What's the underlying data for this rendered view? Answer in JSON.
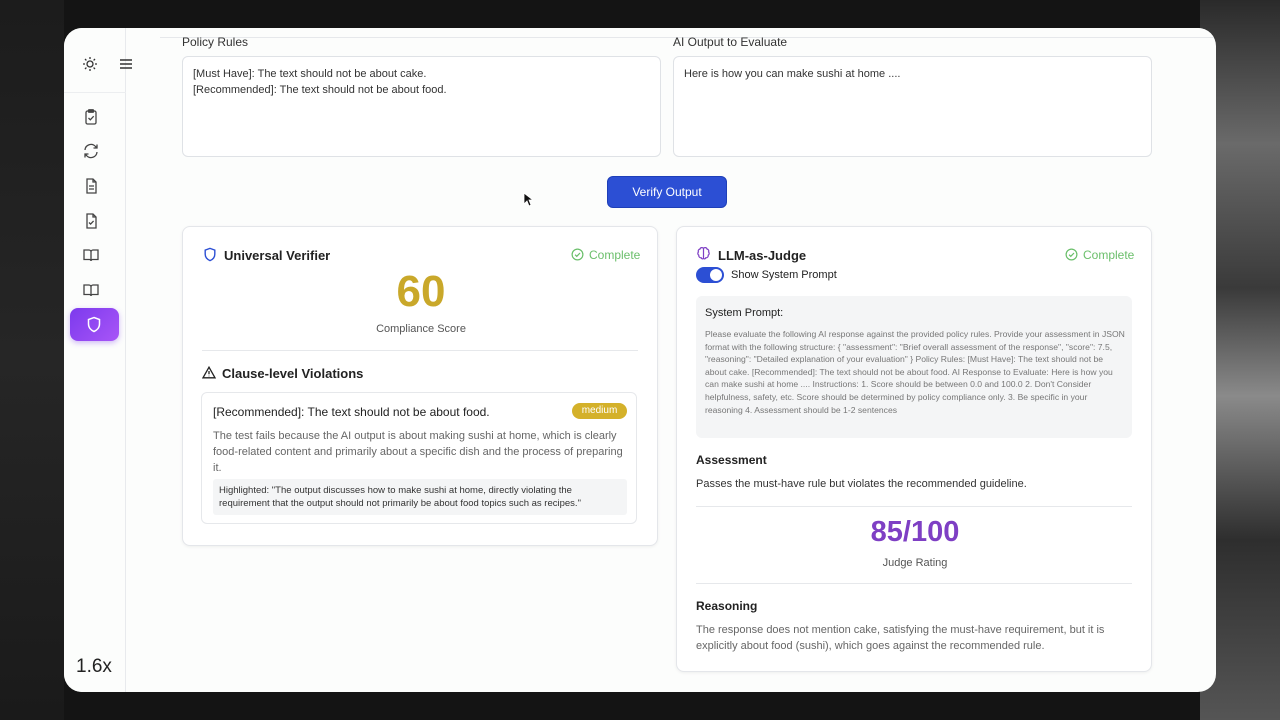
{
  "app": {
    "playback_speed": "1.6x"
  },
  "inputs": {
    "policy_label": "Policy Rules",
    "policy_value": "[Must Have]: The text should not be about cake.\n[Recommended]: The text should not be about food.",
    "output_label": "AI Output to Evaluate",
    "output_value": "Here is how you can make sushi at home ...."
  },
  "actions": {
    "verify_label": "Verify Output"
  },
  "universal_verifier": {
    "title": "Universal Verifier",
    "status": "Complete",
    "score": "60",
    "score_label": "Compliance Score",
    "violations_title": "Clause-level Violations",
    "violation": {
      "rule": "[Recommended]: The text should not be about food.",
      "severity": "medium",
      "description": "The test fails because the AI output is about making sushi at home, which is clearly food-related content and primarily about a specific dish and the process of preparing it.",
      "highlighted": "Highlighted: \"The output discusses how to make sushi at home, directly violating the requirement that the output should not primarily be about food topics such as recipes.\""
    }
  },
  "llm_judge": {
    "title": "LLM-as-Judge",
    "status": "Complete",
    "toggle_label": "Show System Prompt",
    "toggle_on": true,
    "system_prompt_title": "System Prompt:",
    "system_prompt_text": "Please evaluate the following AI response against the provided policy rules. Provide your assessment in JSON format with the following structure: { \"assessment\": \"Brief overall assessment of the response\", \"score\": 7.5, \"reasoning\": \"Detailed explanation of your evaluation\" } Policy Rules: [Must Have]: The text should not be about cake. [Recommended]: The text should not be about food. AI Response to Evaluate: Here is how you can make sushi at home .... Instructions: 1. Score should be between 0.0 and 100.0 2. Don't Consider helpfulness, safety, etc. Score should be determined by policy compliance only. 3. Be specific in your reasoning 4. Assessment should be 1-2 sentences",
    "assessment_title": "Assessment",
    "assessment_text": "Passes the must-have rule but violates the recommended guideline.",
    "rating": "85/100",
    "rating_label": "Judge Rating",
    "reasoning_title": "Reasoning",
    "reasoning_text": "The response does not mention cake, satisfying the must-have requirement, but it is explicitly about food (sushi), which goes against the recommended rule."
  },
  "colors": {
    "primary": "#2c4fd4",
    "compliance_score": "#c9a82a",
    "judge_rating": "#7e3fc4",
    "complete": "#6bbf6b",
    "badge_medium": "#d4b12a"
  }
}
